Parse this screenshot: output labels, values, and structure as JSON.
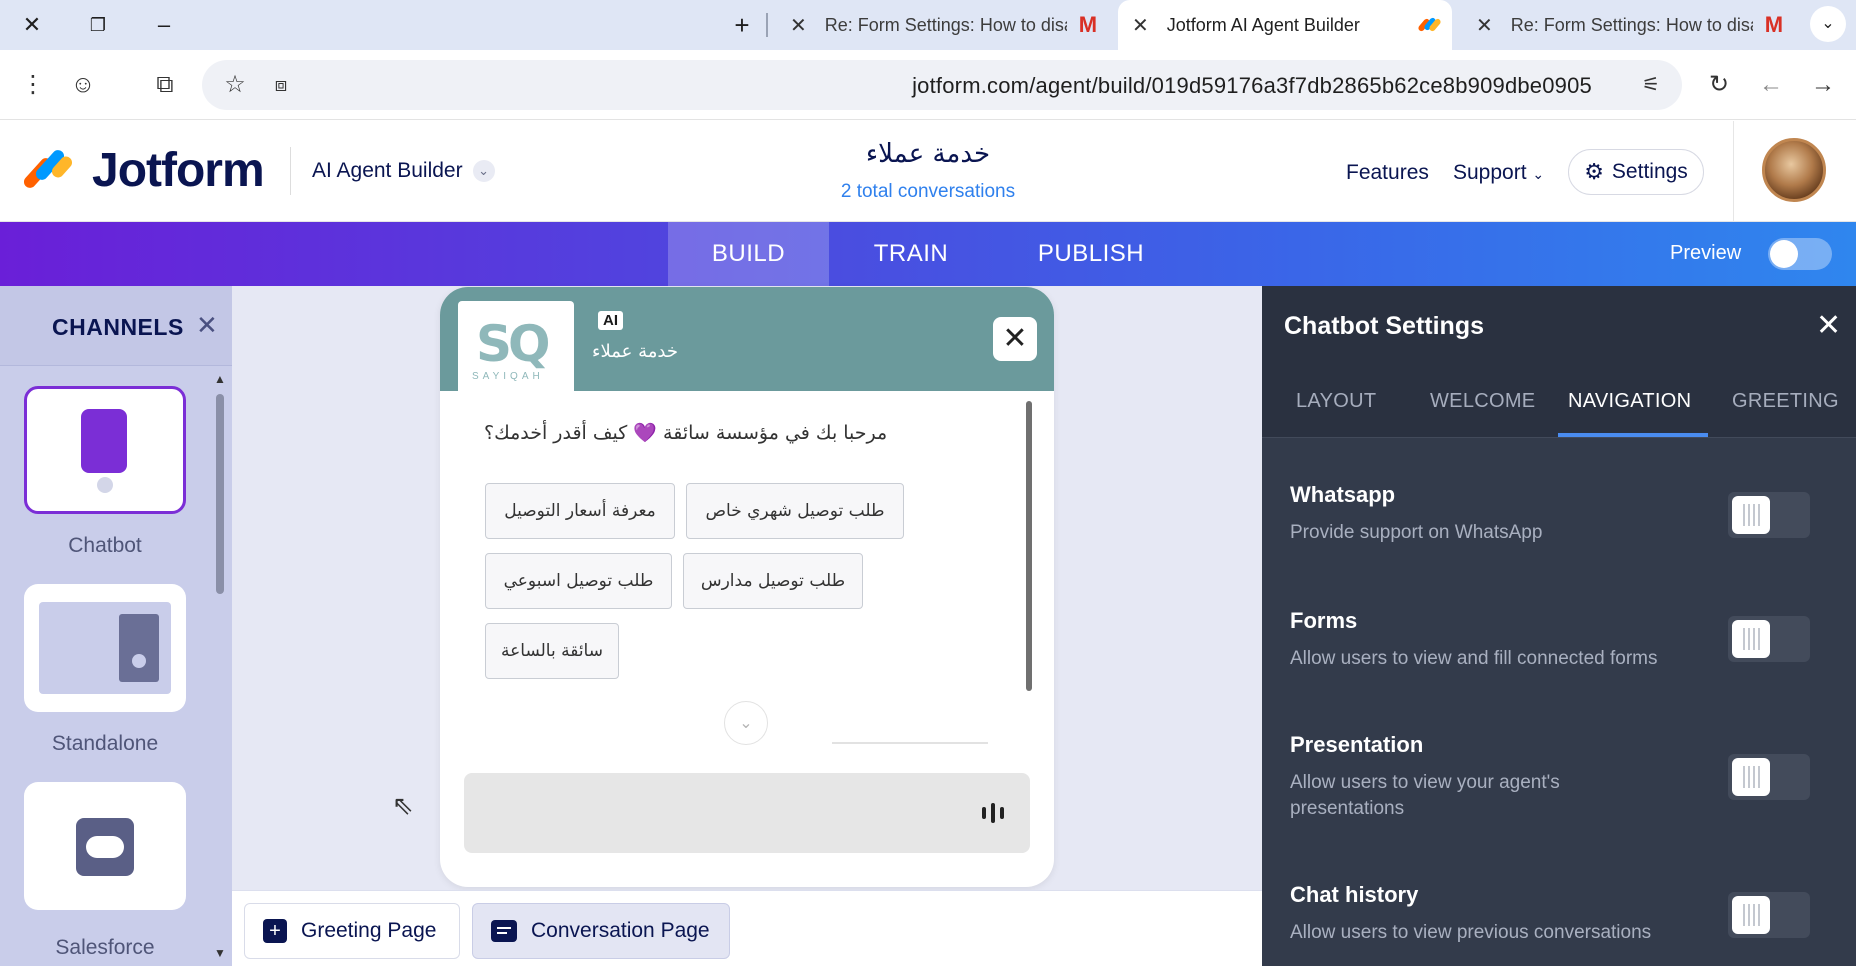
{
  "browser": {
    "tabs": [
      {
        "title": "Re: Form Settings: How to disal",
        "favicon": "gmail-icon"
      },
      {
        "title": "Jotform AI Agent Builder",
        "favicon": "jotform-icon"
      },
      {
        "title": "Re: Form Settings: How to disal",
        "favicon": "gmail-icon"
      }
    ],
    "url": "jotform.com/agent/build/019d59176a3f7db2865b62ce8b909dbe0905"
  },
  "header": {
    "brand": "Jotform",
    "product": "AI Agent Builder",
    "agent_name": "خدمة عملاء",
    "conversations": "2 total conversations",
    "nav_features": "Features",
    "nav_support": "Support",
    "settings_label": "Settings"
  },
  "navbar": {
    "tabs": [
      "BUILD",
      "TRAIN",
      "PUBLISH"
    ],
    "active_tab": "BUILD",
    "preview_label": "Preview",
    "preview_on": false
  },
  "channels": {
    "title": "CHANNELS",
    "items": [
      {
        "label": "Chatbot",
        "active": true
      },
      {
        "label": "Standalone",
        "active": false
      },
      {
        "label": "Salesforce",
        "active": false
      }
    ]
  },
  "chat": {
    "ai_badge": "AI",
    "name": "خدمة عملاء",
    "welcome": "مرحبا بك في مؤسسة سائقة 💜 كيف أقدر أخدمك؟",
    "quick_replies": [
      "طلب توصيل شهري خاص",
      "معرفة أسعار التوصيل",
      "طلب توصيل مدارس",
      "طلب توصيل اسبوعي",
      "سائقة بالساعة"
    ]
  },
  "bottom": {
    "greeting_page": "Greeting Page",
    "conversation_page": "Conversation Page"
  },
  "settings_panel": {
    "title": "Chatbot Settings",
    "tabs": [
      "LAYOUT",
      "WELCOME",
      "NAVIGATION",
      "GREETING"
    ],
    "active_tab": "NAVIGATION",
    "options": [
      {
        "title": "Whatsapp",
        "desc": "Provide support on WhatsApp",
        "enabled": false
      },
      {
        "title": "Forms",
        "desc": "Allow users to view and fill connected forms",
        "enabled": false
      },
      {
        "title": "Presentation",
        "desc": "Allow users to view your agent's presentations",
        "enabled": false
      },
      {
        "title": "Chat history",
        "desc": "Allow users to view previous conversations",
        "enabled": false
      }
    ]
  },
  "colors": {
    "brand_navy": "#0a1551",
    "accent_purple": "#7b2ed6",
    "chat_header": "#6b9a9c",
    "panel_bg": "#333b4b"
  }
}
